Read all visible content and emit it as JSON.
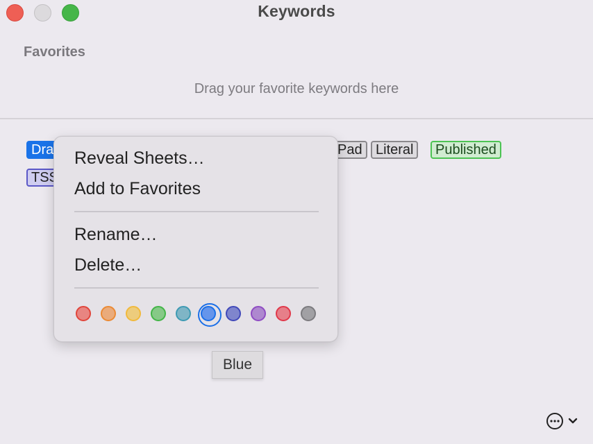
{
  "window": {
    "title": "Keywords",
    "controls": [
      "close",
      "minimize",
      "zoom"
    ]
  },
  "favorites": {
    "heading": "Favorites",
    "placeholder": "Drag your favorite keywords here"
  },
  "keywords": [
    {
      "label": "Draft",
      "visible_text": "Dra",
      "style": "selected",
      "color": "#1a73e8"
    },
    {
      "label": "TSS",
      "visible_text": "TSS",
      "style": "tss",
      "color": "#5b58c7"
    },
    {
      "label": "Pad",
      "visible_text": "Pad",
      "style": "gray",
      "color": "#8a888c"
    },
    {
      "label": "Literal",
      "visible_text": "Literal",
      "style": "gray",
      "color": "#8a888c"
    },
    {
      "label": "Published",
      "visible_text": "Published",
      "style": "green",
      "color": "#4cc353"
    }
  ],
  "context_menu": {
    "items": [
      {
        "label": "Reveal Sheets…"
      },
      {
        "label": "Add to Favorites"
      },
      {
        "label": "Rename…"
      },
      {
        "label": "Delete…"
      }
    ],
    "colors": [
      {
        "name": "Red",
        "fill": "#e88581",
        "stroke": "#e0453b"
      },
      {
        "name": "Orange",
        "fill": "#eaab7b",
        "stroke": "#eb8a34"
      },
      {
        "name": "Yellow",
        "fill": "#edcc7c",
        "stroke": "#f1b93c"
      },
      {
        "name": "Green",
        "fill": "#86c987",
        "stroke": "#43b548"
      },
      {
        "name": "Teal",
        "fill": "#7fb5c6",
        "stroke": "#3e9ab3"
      },
      {
        "name": "Blue",
        "fill": "#6595eb",
        "stroke": "#1a6fe8",
        "selected": true
      },
      {
        "name": "Indigo",
        "fill": "#7f85cd",
        "stroke": "#4149b9"
      },
      {
        "name": "Purple",
        "fill": "#ae88cf",
        "stroke": "#8f4cc3"
      },
      {
        "name": "Pink",
        "fill": "#e67f89",
        "stroke": "#e0384a"
      },
      {
        "name": "Gray",
        "fill": "#a1a0a4",
        "stroke": "#7c7b7f"
      }
    ]
  },
  "tooltip": {
    "text": "Blue"
  },
  "footer": {
    "action_icon": "ellipsis-circle-icon",
    "chevron_icon": "chevron-down-icon"
  }
}
